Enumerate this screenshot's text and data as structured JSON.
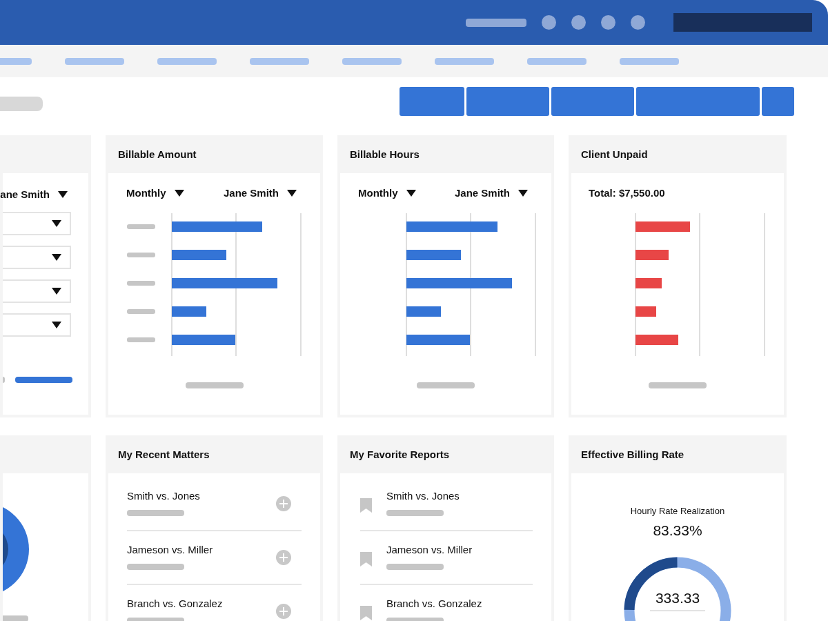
{
  "cards": [
    {
      "kind": "filters",
      "filter": "ane Smith"
    },
    {
      "kind": "bar-chart",
      "title": "Billable Amount",
      "filters": [
        "Monthly",
        "Jane Smith"
      ],
      "color": "#3474d6"
    },
    {
      "kind": "bar-chart",
      "title": "Billable Hours",
      "filters": [
        "Monthly",
        "Jane Smith"
      ],
      "color": "#3474d6"
    },
    {
      "kind": "bar-chart",
      "title": "Client Unpaid",
      "total": "Total: $7,550.00",
      "color": "#e84646"
    },
    {
      "kind": "donut"
    },
    {
      "kind": "add-list",
      "title": "My Recent Matters",
      "items": [
        "Smith vs. Jones",
        "Jameson vs. Miller",
        "Branch vs. Gonzalez"
      ]
    },
    {
      "kind": "bookmark-list",
      "title": "My Favorite Reports",
      "items": [
        "Smith vs. Jones",
        "Jameson vs. Miller",
        "Branch vs. Gonzalez"
      ]
    },
    {
      "kind": "gauge",
      "title": "Effective Billing Rate",
      "caption": "Hourly Rate Realization",
      "percent": "83.33%",
      "value": "333.33"
    }
  ]
}
